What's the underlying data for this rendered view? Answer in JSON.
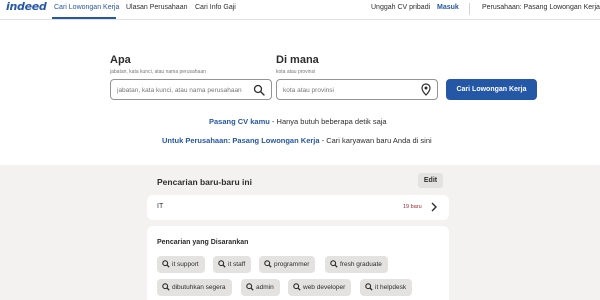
{
  "header": {
    "logo": "indeed",
    "nav": [
      "Cari Lowongan Kerja",
      "Ulasan Perusahaan",
      "Cari Info Gaji"
    ],
    "right": {
      "upload_cv": "Unggah CV pribadi",
      "login": "Masuk",
      "employers": "Perusahaan: Pasang Lowongan Kerja"
    }
  },
  "search": {
    "what_label": "Apa",
    "what_sub": "jabatan, kata kunci, atau nama perusahaan",
    "what_placeholder": "jabatan, kata kunci, atau nama perusahaan",
    "where_label": "Di mana",
    "where_sub": "kota atau provinsi",
    "where_placeholder": "kota atau provinsi",
    "button": "Cari Lowongan Kerja"
  },
  "promos": [
    {
      "link": "Pasang CV kamu",
      "text": " - Hanya butuh beberapa detik saja"
    },
    {
      "link": "Untuk Perusahaan: Pasang Lowongan Kerja",
      "text": " - Cari karyawan baru Anda di sini"
    }
  ],
  "recent": {
    "title": "Pencarian baru-baru ini",
    "edit": "Edit",
    "items": [
      {
        "query": "IT",
        "count": "19 baru"
      }
    ]
  },
  "suggested": {
    "title": "Pencarian yang Disarankan",
    "chips": [
      "it support",
      "it staff",
      "programmer",
      "fresh graduate",
      "dibutuhkan segera",
      "admin",
      "web developer",
      "it helpdesk"
    ]
  },
  "colors": {
    "brand": "#2557a7",
    "new_count": "#a9252b",
    "lower_bg": "#f3f2f1"
  },
  "icons": [
    "search-icon",
    "location-pin-icon",
    "chevron-right-icon",
    "magnifier-icon"
  ]
}
